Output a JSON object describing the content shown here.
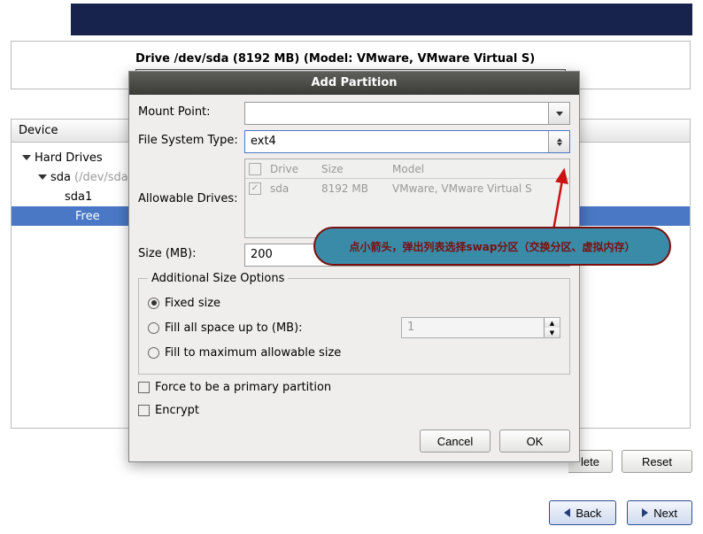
{
  "drive_header": "Drive /dev/sda (8192 MB) (Model: VMware, VMware Virtual S)",
  "columns": {
    "device": "Device"
  },
  "tree": {
    "hard_drives": "Hard Drives",
    "sda": "sda",
    "sda_dev": "(/dev/sda)",
    "sda1": "sda1",
    "free": "Free"
  },
  "dialog": {
    "title": "Add Partition",
    "mount_point_label": "Mount Point:",
    "mount_point_value": "",
    "fs_type_label": "File System Type:",
    "fs_type_value": "ext4",
    "allowable_drives_label": "Allowable Drives:",
    "drives_table": {
      "headers": {
        "drive": "Drive",
        "size": "Size",
        "model": "Model"
      },
      "row": {
        "drive": "sda",
        "size": "8192 MB",
        "model": "VMware, VMware Virtual S"
      }
    },
    "size_label": "Size (MB):",
    "size_value": "200",
    "additional_legend": "Additional Size Options",
    "fixed_size": "Fixed size",
    "fill_up_to": "Fill all space up to (MB):",
    "fill_up_to_value": "1",
    "fill_max": "Fill to maximum allowable size",
    "force_primary": "Force to be a primary partition",
    "encrypt": "Encrypt",
    "cancel": "Cancel",
    "ok": "OK"
  },
  "upper_buttons": {
    "delete_suffix": "lete",
    "reset": "Reset"
  },
  "nav": {
    "back": "Back",
    "next": "Next"
  },
  "annotation": "点小箭头，弹出列表选择swap分区（交换分区、虚拟内存）"
}
